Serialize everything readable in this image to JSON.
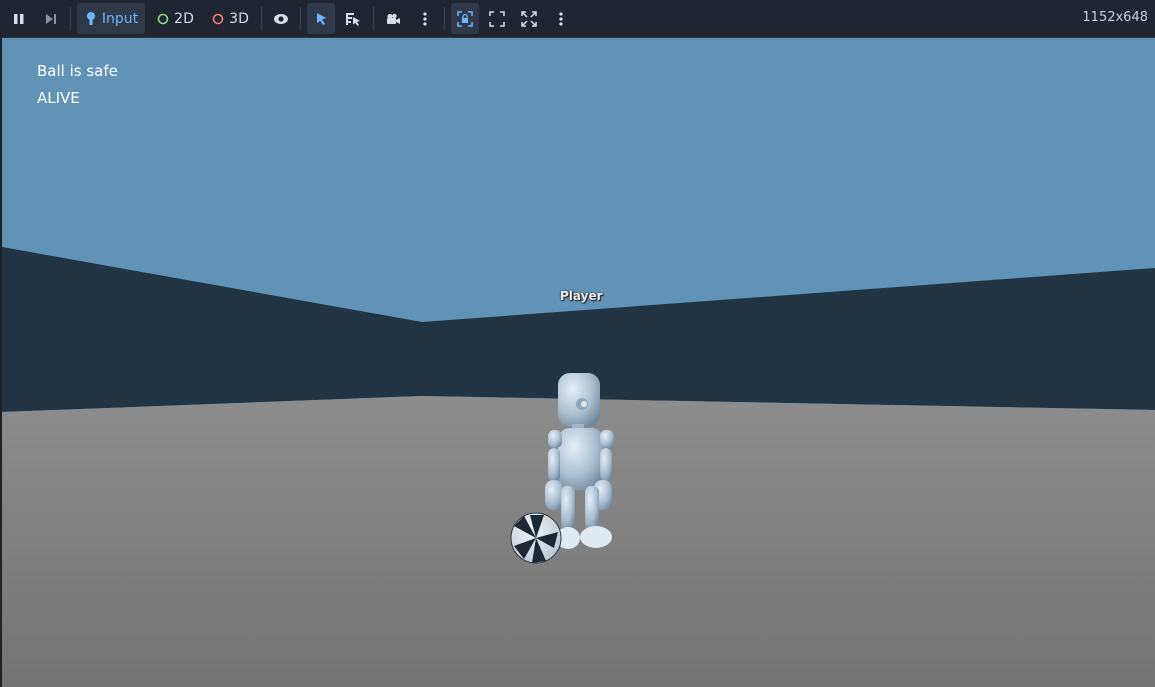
{
  "toolbar": {
    "input_label": "Input",
    "mode_2d_label": "2D",
    "mode_3d_label": "3D",
    "resolution": "1152x648"
  },
  "colors": {
    "accent": "#6db6ff",
    "mode_2d_dot": "#8fd67d",
    "mode_3d_dot": "#fa7a7a",
    "sky": "#6093b6",
    "wall": "#213444",
    "floor": "#808080"
  },
  "hud": {
    "status_line": "Ball is safe",
    "state_line": "ALIVE"
  },
  "scene": {
    "player_label": "Player"
  }
}
